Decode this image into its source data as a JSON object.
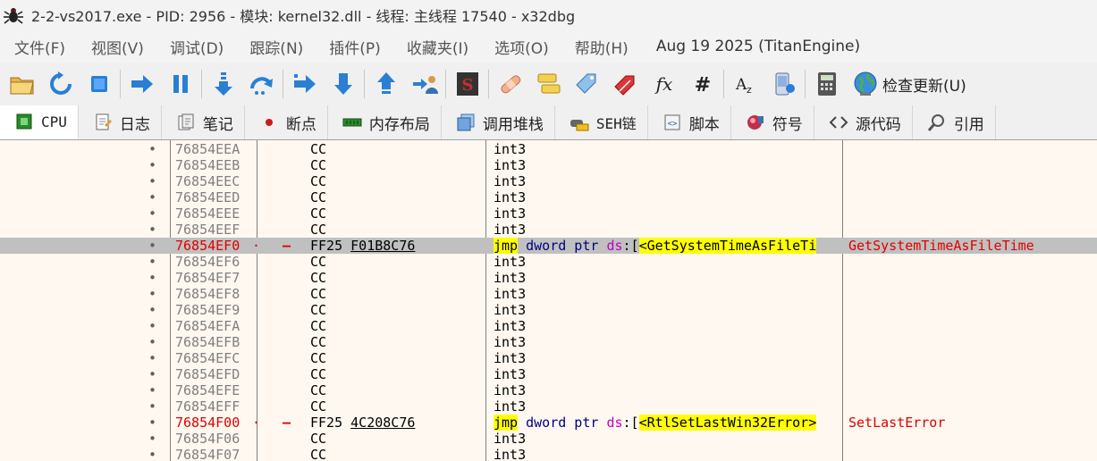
{
  "window": {
    "title": "2-2-vs2017.exe - PID: 2956 - 模块: kernel32.dll - 线程: 主线程 17540 - x32dbg"
  },
  "menu": {
    "items": [
      "文件(F)",
      "视图(V)",
      "调试(D)",
      "跟踪(N)",
      "插件(P)",
      "收藏夹(I)",
      "选项(O)",
      "帮助(H)"
    ],
    "info": "Aug 19 2025 (TitanEngine)"
  },
  "toolbar": {
    "update_label": "检查更新(U)"
  },
  "tabs": [
    "CPU",
    "日志",
    "笔记",
    "断点",
    "内存布局",
    "调用堆栈",
    "SEH链",
    "脚本",
    "符号",
    "源代码",
    "引用"
  ],
  "disasm": {
    "rows": [
      {
        "addr": "76854EEA",
        "bytes": "CC",
        "instr": "int3"
      },
      {
        "addr": "76854EEB",
        "bytes": "CC",
        "instr": "int3"
      },
      {
        "addr": "76854EEC",
        "bytes": "CC",
        "instr": "int3"
      },
      {
        "addr": "76854EED",
        "bytes": "CC",
        "instr": "int3"
      },
      {
        "addr": "76854EEE",
        "bytes": "CC",
        "instr": "int3"
      },
      {
        "addr": "76854EEF",
        "bytes": "CC",
        "instr": "int3"
      },
      {
        "addr": "76854EF0",
        "bytes_op": "FF25",
        "bytes_arg": "F01B8C76",
        "mnemonic": "jmp",
        "size": "dword ptr",
        "segment": "ds",
        "symbol": "<GetSystemTimeAsFileTi",
        "comment": "GetSystemTimeAsFileTime",
        "breakpoint": true,
        "selected": true
      },
      {
        "addr": "76854EF6",
        "bytes": "CC",
        "instr": "int3"
      },
      {
        "addr": "76854EF7",
        "bytes": "CC",
        "instr": "int3"
      },
      {
        "addr": "76854EF8",
        "bytes": "CC",
        "instr": "int3"
      },
      {
        "addr": "76854EF9",
        "bytes": "CC",
        "instr": "int3"
      },
      {
        "addr": "76854EFA",
        "bytes": "CC",
        "instr": "int3"
      },
      {
        "addr": "76854EFB",
        "bytes": "CC",
        "instr": "int3"
      },
      {
        "addr": "76854EFC",
        "bytes": "CC",
        "instr": "int3"
      },
      {
        "addr": "76854EFD",
        "bytes": "CC",
        "instr": "int3"
      },
      {
        "addr": "76854EFE",
        "bytes": "CC",
        "instr": "int3"
      },
      {
        "addr": "76854EFF",
        "bytes": "CC",
        "instr": "int3"
      },
      {
        "addr": "76854F00",
        "bytes_op": "FF25",
        "bytes_arg": "4C208C76",
        "mnemonic": "jmp",
        "size": "dword ptr",
        "segment": "ds",
        "symbol": "<RtlSetLastWin32Error>",
        "comment": "SetLastError",
        "breakpoint": true,
        "selected": false
      },
      {
        "addr": "76854F06",
        "bytes": "CC",
        "instr": "int3"
      },
      {
        "addr": "76854F07",
        "bytes": "CC",
        "instr": "int3"
      }
    ]
  },
  "colors": {
    "disasm_bg": "#fff8f0",
    "breakpoint_red": "#e00000",
    "highlight_yellow": "#ffff00",
    "selected_row": "#c0c0c0"
  }
}
